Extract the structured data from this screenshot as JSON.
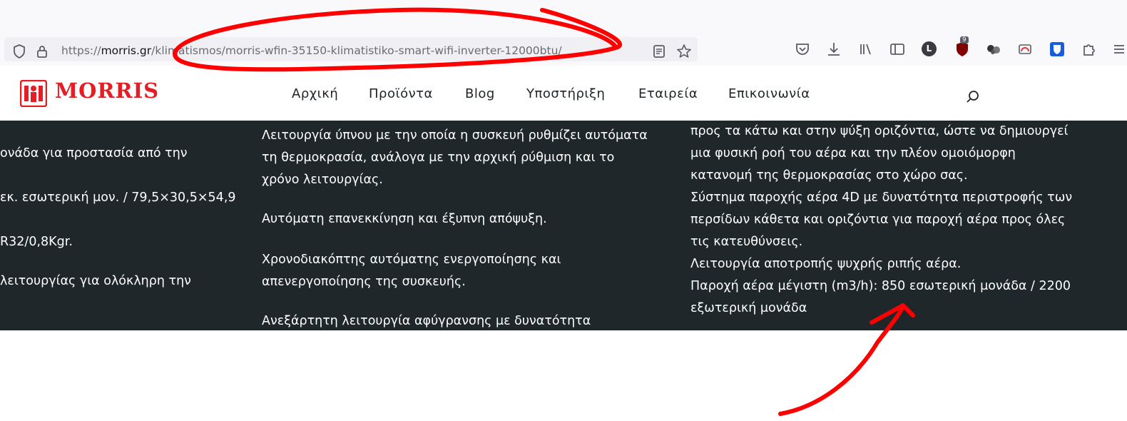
{
  "browser": {
    "url_prefix": "https://",
    "url_host": "morris.gr",
    "url_path": "/klimatismos/morris-wfin-35150-klimatistiko-smart-wifi-inverter-12000btu/",
    "extension_badge_count": "9",
    "profile_initial": "L"
  },
  "site": {
    "logo_text": "MORRIS",
    "brand_color": "#e31e24",
    "nav": [
      "Αρχική",
      "Προϊόντα",
      "Blog",
      "Υποστήριξη",
      "Εταιρεία",
      "Επικοινωνία"
    ]
  },
  "content": {
    "col1": [
      "ονάδα για προστασία από την",
      "εκ. εσωτερική μον. / 79,5×30,5×54,9",
      "R32/0,8Kgr.",
      "λειτουργίας για ολόκληρη την"
    ],
    "col2": [
      "Λειτουργία ύπνου με την οποία η συσκευή ρυθμίζει αυτόματα",
      "τη θερμοκρασία, ανάλογα με την αρχική ρύθμιση και το",
      "χρόνο λειτουργίας.",
      "Αυτόματη επανεκκίνηση και έξυπνη απόψυξη.",
      "Χρονοδιακόπτης αυτόματης ενεργοποίησης και",
      "απενεργοποίησης της συσκευής.",
      "Ανεξάρτητη λειτουργία αφύγρανσης με δυνατότητα"
    ],
    "col3": [
      "προς τα κάτω και στην ψύξη οριζόντια, ώστε να δημιουργεί",
      "μια φυσική ροή του αέρα και την πλέον ομοιόμορφη",
      "κατανομή της θερμοκρασίας στο χώρο σας.",
      "Σύστημα παροχής αέρα 4D με δυνατότητα περιστροφής των",
      "περσίδων κάθετα και οριζόντια για παροχή αέρα προς όλες",
      "τις κατευθύνσεις.",
      "Λειτουργία αποτροπής ψυχρής ριπής αέρα.",
      "Παροχή αέρα μέγιστη (m3/h): 850 εσωτερική μονάδα / 2200",
      "εξωτερική μονάδα"
    ]
  },
  "colors": {
    "content_bg": "#1f272a",
    "annotation": "#ff0000"
  }
}
